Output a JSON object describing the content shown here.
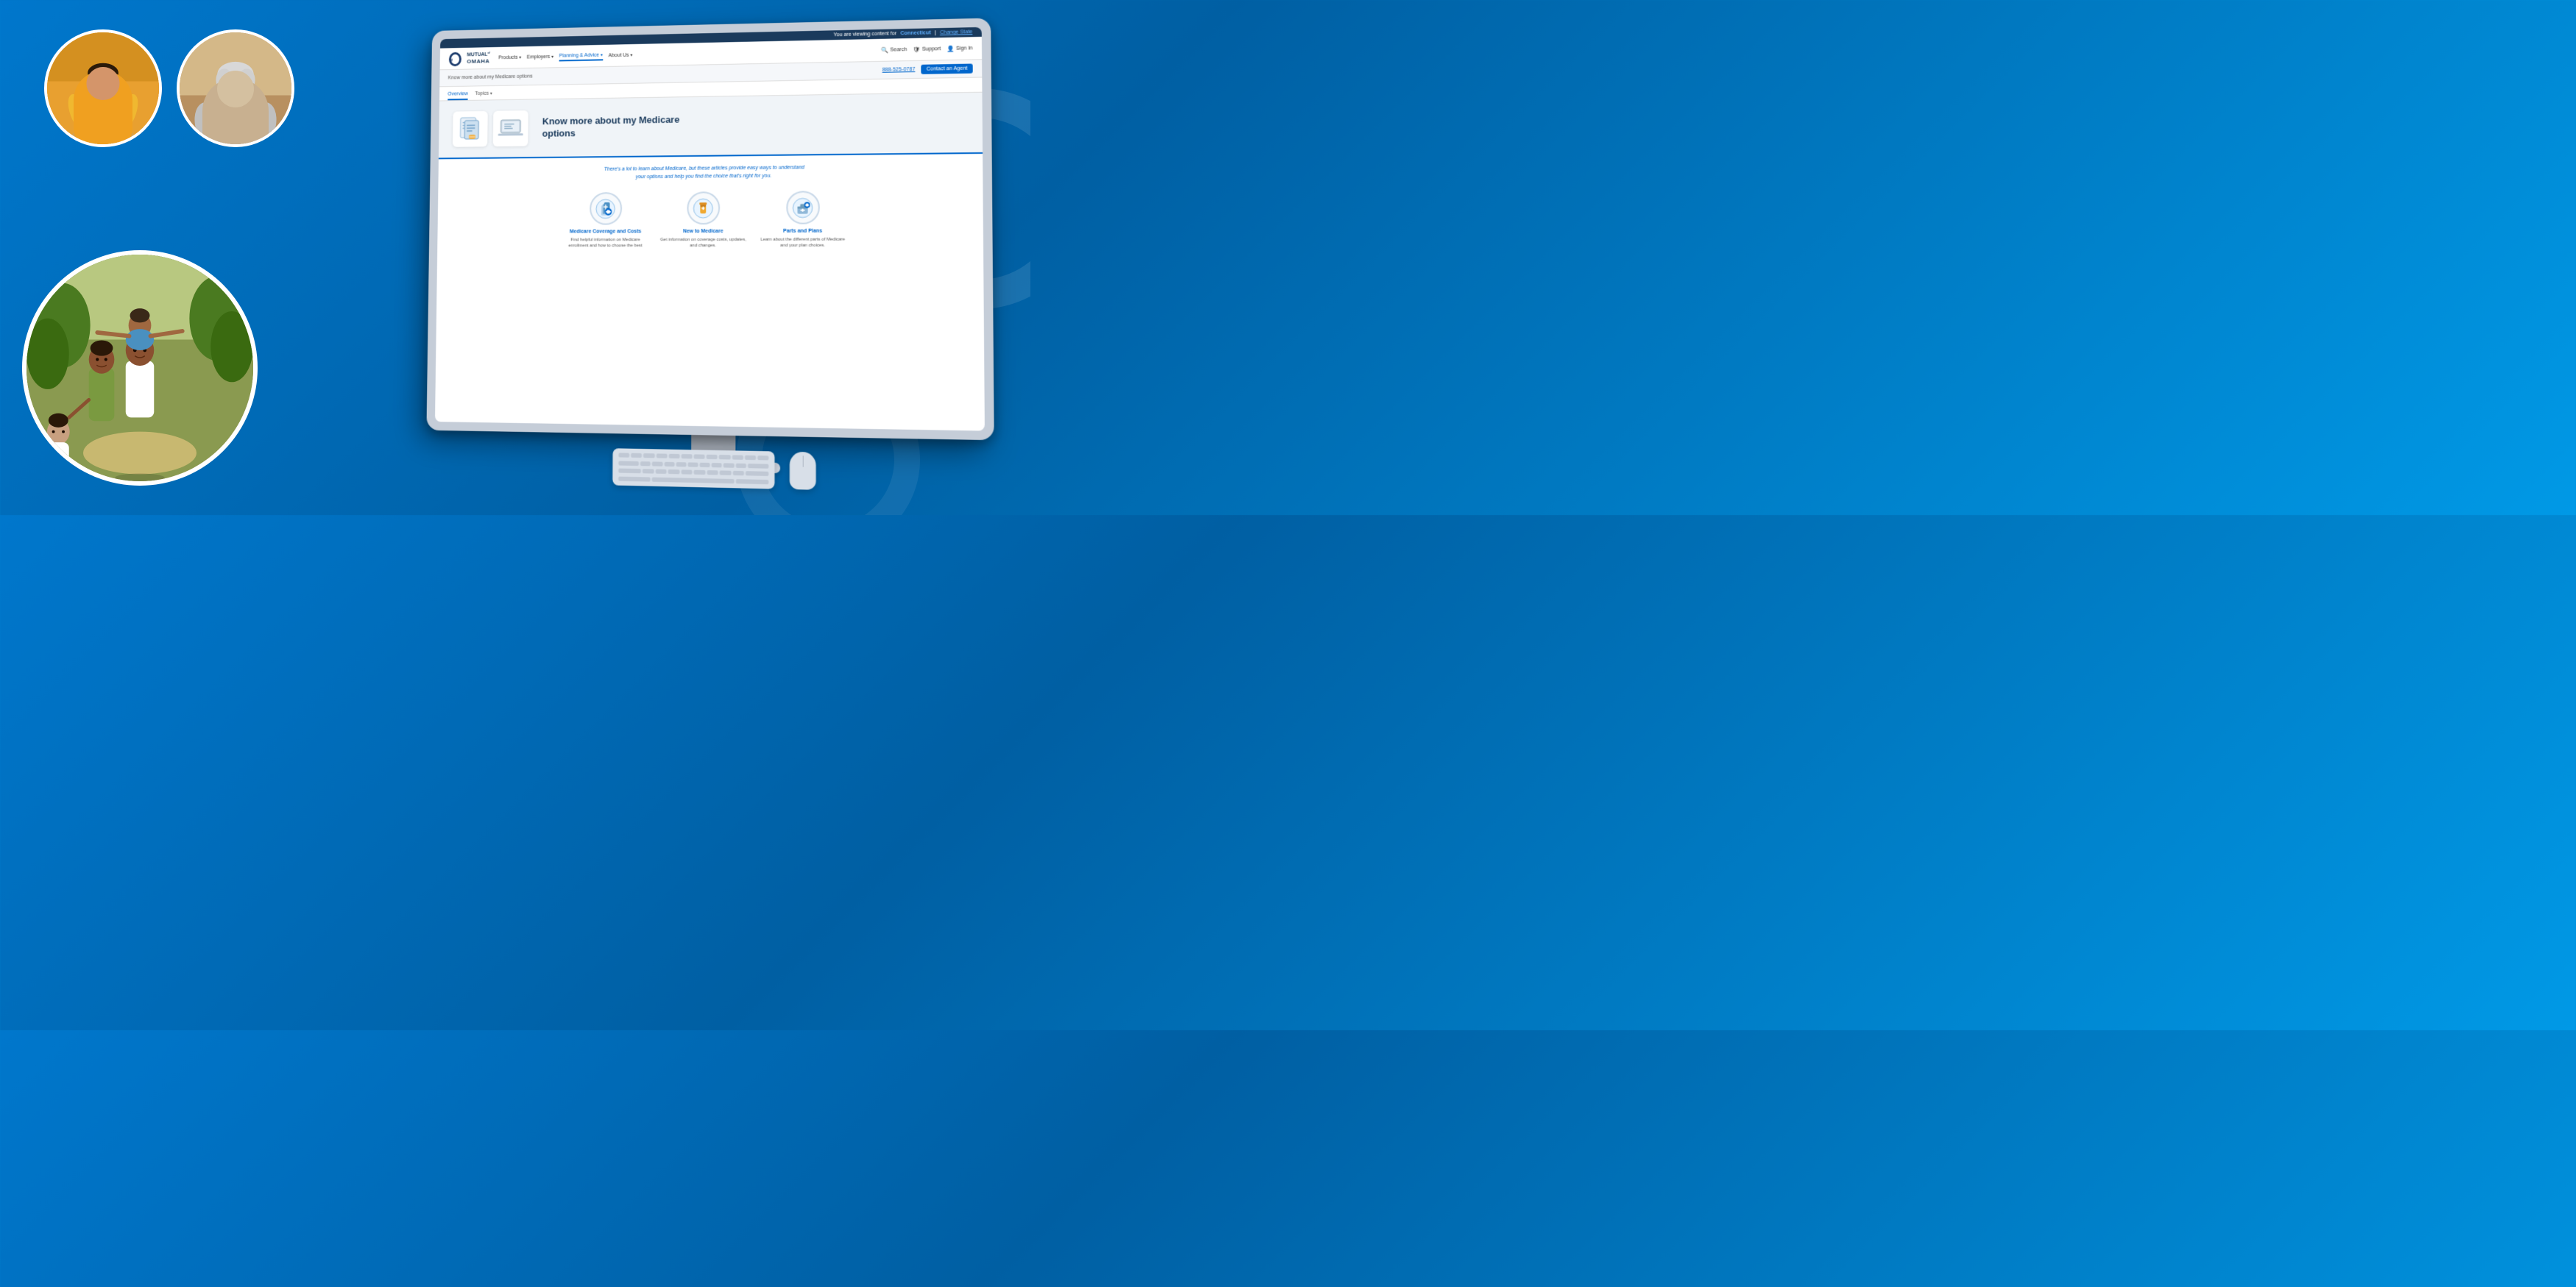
{
  "page": {
    "background_color": "#0077cc"
  },
  "top_bar": {
    "viewing_text": "You are viewing content for",
    "state": "Connecticut",
    "change_state_label": "Change State"
  },
  "nav": {
    "logo_text": "MUTUAL of OMAHA",
    "logo_tagline": "",
    "items": [
      {
        "id": "products",
        "label": "Products",
        "has_dropdown": true,
        "active": false
      },
      {
        "id": "employers",
        "label": "Employers",
        "has_dropdown": true,
        "active": false
      },
      {
        "id": "planning",
        "label": "Planning & Advice",
        "has_dropdown": true,
        "active": true
      },
      {
        "id": "about",
        "label": "About Us",
        "has_dropdown": true,
        "active": false
      }
    ],
    "search_label": "Search",
    "support_label": "Support",
    "signin_label": "Sign In"
  },
  "sub_header": {
    "breadcrumb": "Know more about my Medicare options",
    "phone": "888-525-0787",
    "contact_agent_label": "Contact an Agent"
  },
  "tabs": [
    {
      "id": "overview",
      "label": "Overview",
      "active": true
    },
    {
      "id": "topics",
      "label": "Topics",
      "has_dropdown": true,
      "active": false
    }
  ],
  "hero": {
    "title_line1": "Know more about my Medicare",
    "title_line2": "options"
  },
  "content": {
    "intro_text": "There's a lot to learn about Medicare, but these articles provide easy ways to understand\nyour options and help you find the choice that's right for you.",
    "cards": [
      {
        "id": "coverage-costs",
        "title": "Medicare Coverage and Costs",
        "description": "Find helpful information on Medicare enrollment and how to choose the best"
      },
      {
        "id": "new-to-medicare",
        "title": "New to Medicare",
        "description": "Get information on coverage costs, updates, and changes."
      },
      {
        "id": "parts-plans",
        "title": "Parts and Plans",
        "description": "Learn about the different parts of Medicare and your plan choices."
      }
    ]
  },
  "photos": {
    "circle1_alt": "Child in yellow raincoat",
    "circle2_alt": "Elderly woman smiling",
    "large_circle_alt": "Happy family walking"
  }
}
